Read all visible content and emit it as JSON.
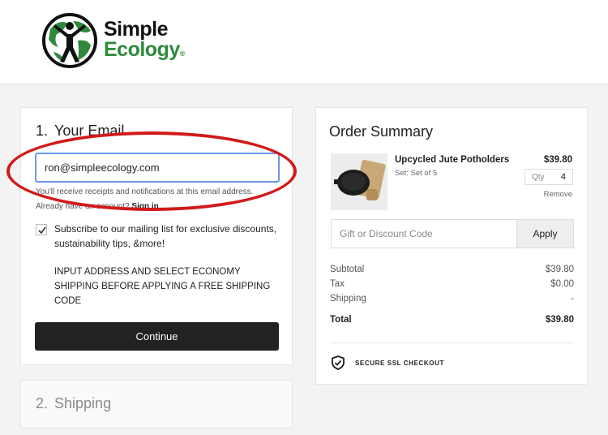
{
  "brand": {
    "line1": "Simple",
    "line2": "Ecology",
    "reg": "®"
  },
  "email_step": {
    "number": "1.",
    "title": "Your Email",
    "email_value": "ron@simpleecology.com",
    "hint": "You'll receive receipts and notifications at this email address.",
    "account_prompt": "Already have an account?",
    "sign_in": "Sign in",
    "subscribe_checked": true,
    "subscribe_text": "Subscribe to our mailing list for exclusive discounts, sustainability tips, &more!",
    "notice": "INPUT ADDRESS AND SELECT ECONOMY SHIPPING BEFORE APPLYING A FREE SHIPPING CODE",
    "continue_label": "Continue"
  },
  "shipping_step": {
    "number": "2.",
    "title": "Shipping"
  },
  "order_summary": {
    "title": "Order Summary",
    "item": {
      "name": "Upcycled Jute Potholders",
      "variant": "Set: Set of 5",
      "price": "$39.80",
      "qty_label": "Qty",
      "qty_value": "4",
      "remove_label": "Remove"
    },
    "discount_placeholder": "Gift or Discount Code",
    "apply_label": "Apply",
    "subtotal_label": "Subtotal",
    "subtotal_value": "$39.80",
    "tax_label": "Tax",
    "tax_value": "$0.00",
    "shipping_label": "Shipping",
    "shipping_value": "-",
    "total_label": "Total",
    "total_value": "$39.80",
    "secure_label": "SECURE SSL CHECKOUT"
  },
  "colors": {
    "accent_green": "#2e8a3a",
    "highlight_red": "#d11a1a",
    "focus_blue": "#6b97e6",
    "button_dark": "#222222"
  },
  "icons": [
    "globe-person-logo-icon",
    "checkmark-icon",
    "shield-check-icon"
  ]
}
